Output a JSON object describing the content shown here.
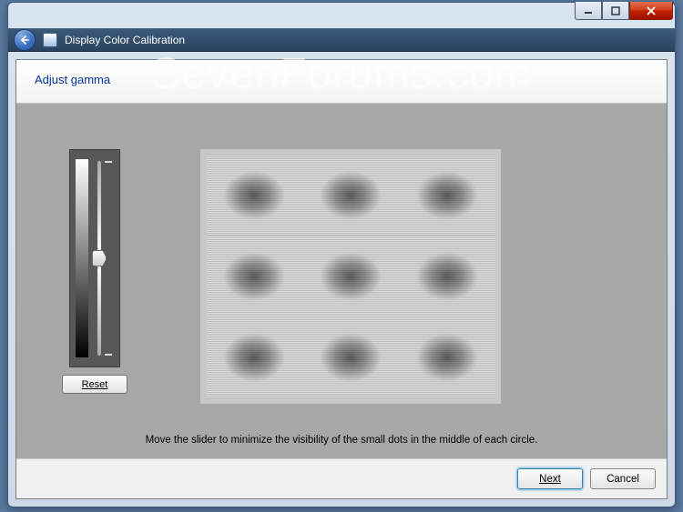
{
  "window": {
    "app_title": "Display Color Calibration"
  },
  "header": {
    "title": "Adjust gamma"
  },
  "slider": {
    "reset_label": "Reset"
  },
  "instruction": "Move the slider to minimize the visibility of the small dots in the middle of each circle.",
  "footer": {
    "next_label": "Next",
    "cancel_label": "Cancel"
  },
  "watermark": "SevenForums.com"
}
